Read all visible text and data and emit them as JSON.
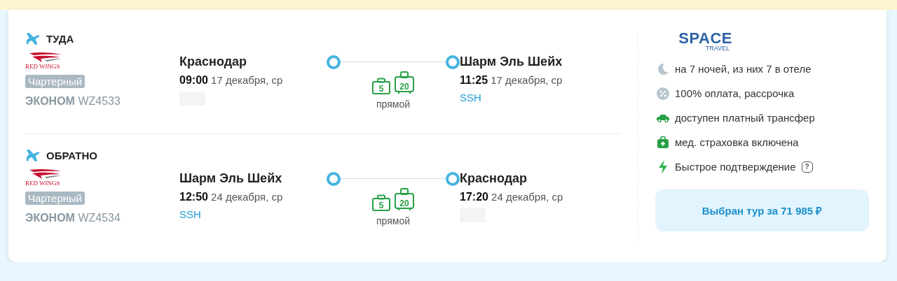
{
  "segments": [
    {
      "direction": "ТУДА",
      "airline": "RED WINGS",
      "charter": "Чартерный",
      "cabin": "ЭКОНОМ",
      "flight": "WZ4533",
      "departure": {
        "city": "Краснодар",
        "time": "09:00",
        "date": "17 декабря, ср"
      },
      "route": {
        "hand_bag": "5",
        "baggage": "20",
        "type": "прямой"
      },
      "arrival": {
        "city": "Шарм Эль Шейх",
        "time": "11:25",
        "date": "17 декабря, ср",
        "code": "SSH"
      }
    },
    {
      "direction": "ОБРАТНО",
      "airline": "RED WINGS",
      "charter": "Чартерный",
      "cabin": "ЭКОНОМ",
      "flight": "WZ4534",
      "departure": {
        "city": "Шарм Эль Шейх",
        "time": "12:50",
        "date": "24 декабря, ср",
        "code": "SSH"
      },
      "route": {
        "hand_bag": "5",
        "baggage": "20",
        "type": "прямой"
      },
      "arrival": {
        "city": "Краснодар",
        "time": "17:20",
        "date": "24 декабря, ср"
      }
    }
  ],
  "operator": {
    "name": "SPACE",
    "sub": "TRAVEL"
  },
  "features": [
    {
      "kind": "moon",
      "text": "на 7 ночей, из них 7 в отеле"
    },
    {
      "kind": "percent",
      "text": "100% оплата, рассрочка"
    },
    {
      "kind": "car",
      "text": "доступен платный трансфер"
    },
    {
      "kind": "medkit",
      "text": "мед. страховка включена"
    },
    {
      "kind": "bolt",
      "text": "Быстрое подтверждение",
      "help_mark": "?"
    }
  ],
  "button": "Выбран тур за 71 985 ₽"
}
